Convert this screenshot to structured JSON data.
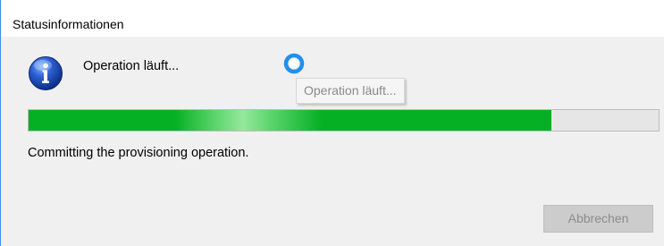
{
  "window": {
    "title": "Statusinformationen"
  },
  "operation": {
    "message": "Operation läuft...",
    "tooltip": "Operation läuft..."
  },
  "progress": {
    "percent": 83,
    "color": "#06b025"
  },
  "status": {
    "detail": "Committing the provisioning operation."
  },
  "buttons": {
    "cancel_label": "Abbrechen",
    "cancel_enabled": false
  },
  "icons": {
    "info": "information-icon",
    "busy": "busy-spinner-icon"
  }
}
